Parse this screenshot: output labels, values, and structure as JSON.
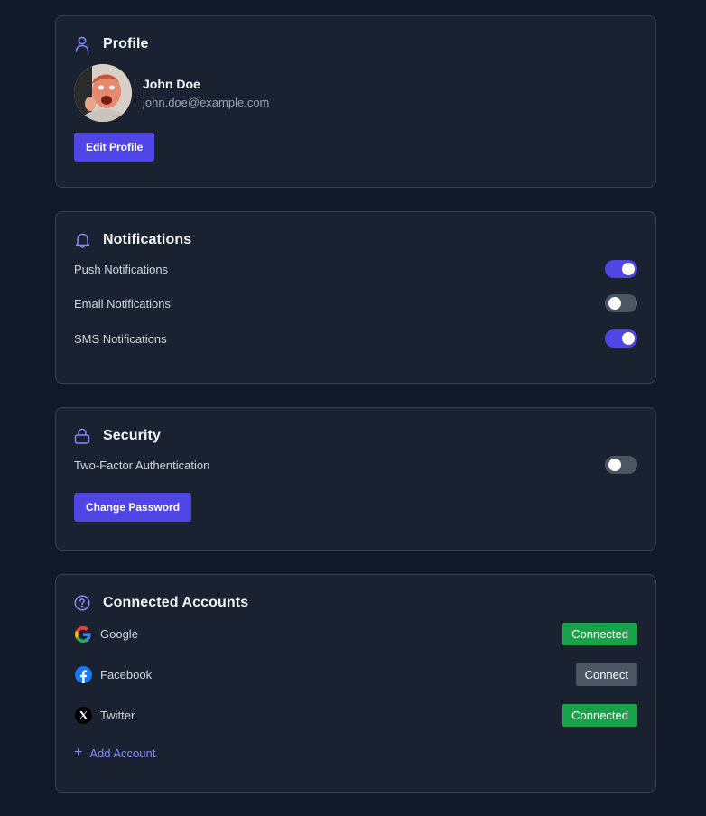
{
  "profile": {
    "title": "Profile",
    "name": "John Doe",
    "email": "john.doe@example.com",
    "edit_label": "Edit Profile"
  },
  "notifications": {
    "title": "Notifications",
    "items": [
      {
        "label": "Push Notifications",
        "enabled": true
      },
      {
        "label": "Email Notifications",
        "enabled": false
      },
      {
        "label": "SMS Notifications",
        "enabled": true
      }
    ]
  },
  "security": {
    "title": "Security",
    "two_factor_label": "Two-Factor Authentication",
    "two_factor_enabled": false,
    "change_password_label": "Change Password"
  },
  "connected_accounts": {
    "title": "Connected Accounts",
    "accounts": [
      {
        "name": "Google",
        "status": "Connected",
        "icon": "google-icon"
      },
      {
        "name": "Facebook",
        "status": "Connect",
        "icon": "facebook-icon"
      },
      {
        "name": "Twitter",
        "status": "Connected",
        "icon": "x-twitter-icon"
      }
    ],
    "add_label": "Add Account"
  },
  "colors": {
    "background": "#111827",
    "card": "#1a2231",
    "accent": "#4f46e5",
    "connected": "#16a34a",
    "neutral": "#4b5563",
    "link": "#818cf8"
  }
}
